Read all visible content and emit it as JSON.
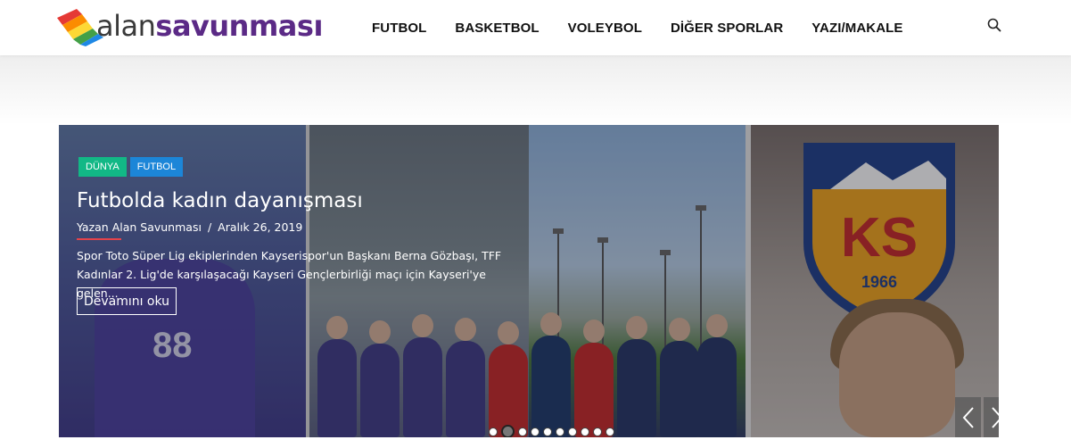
{
  "logo": {
    "part1": "alan",
    "part2": "savunması"
  },
  "nav": {
    "items": [
      "FUTBOL",
      "BASKETBOL",
      "VOLEYBOL",
      "DİĞER SPORLAR",
      "YAZI/MAKALE"
    ]
  },
  "colors": {
    "accent": "#5b2a86",
    "tag_dunya": "#12b886",
    "tag_futbol": "#1c86d8",
    "underline": "#e5434b"
  },
  "icons": {
    "search": "search-icon",
    "prev": "chevron-left-icon",
    "next": "chevron-right-icon"
  },
  "slider": {
    "tags": [
      "DÜNYA",
      "FUTBOL"
    ],
    "title": "Futbolda kadın dayanışması",
    "author": "Yazan Alan Savunması",
    "separator": "/",
    "date": "Aralık 26, 2019",
    "excerpt": "Spor Toto Süper Lig ekiplerinden Kayserispor'un Başkanı Berna Gözbaşı, TFF Kadınlar 2. Lig'de karşılaşacağı Kayseri Gençlerbirliği maçı için Kayseri'ye gelen...",
    "read_more": "Devamını oku",
    "photo_texts": {
      "jersey_number": "88",
      "shield_letters": "KS",
      "shield_year": "1966"
    },
    "slide_count": 10,
    "active_slide": 2
  }
}
